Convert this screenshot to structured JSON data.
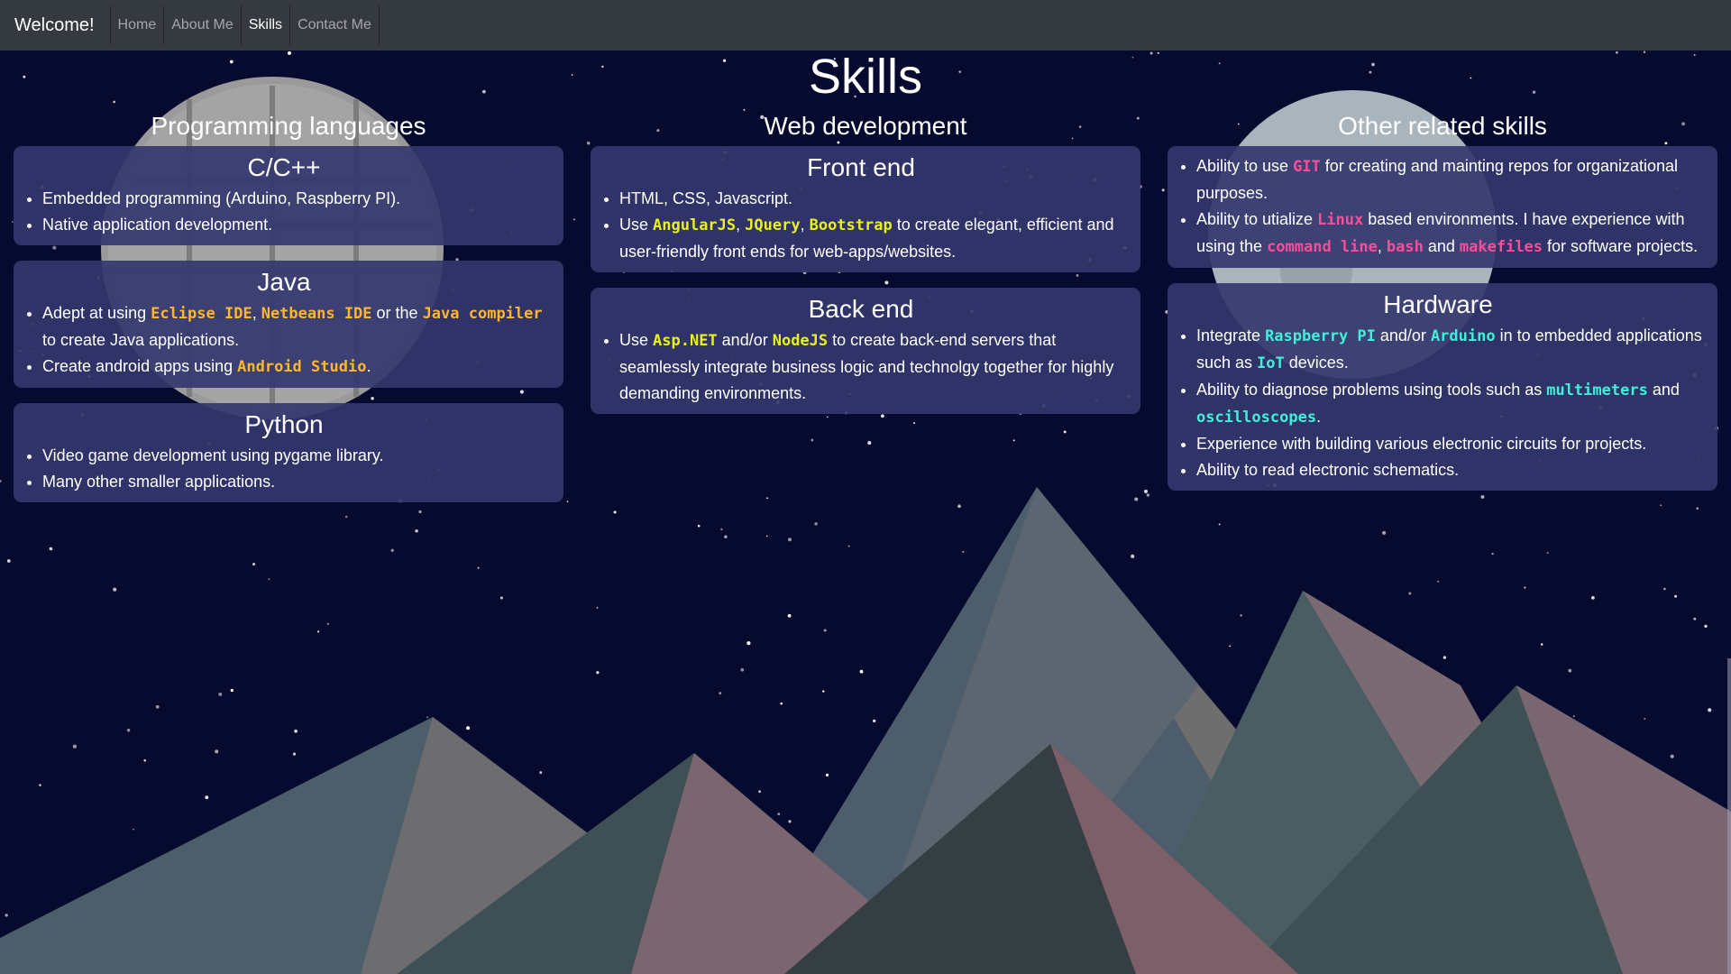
{
  "navbar": {
    "brand": "Welcome!",
    "links": [
      "Home",
      "About Me",
      "Skills",
      "Contact Me"
    ],
    "active": "Skills"
  },
  "page": {
    "title": "Skills"
  },
  "columns": [
    {
      "heading": "Programming languages",
      "cards": [
        {
          "title": "C/C++",
          "items": [
            [
              {
                "t": "Embedded programming (Arduino, Raspberry PI)."
              }
            ],
            [
              {
                "t": "Native application development."
              }
            ]
          ]
        },
        {
          "title": "Java",
          "items": [
            [
              {
                "t": "Adept at using "
              },
              {
                "t": "Eclipse IDE",
                "c": "orange"
              },
              {
                "t": ", "
              },
              {
                "t": "Netbeans IDE",
                "c": "orange"
              },
              {
                "t": " or the "
              },
              {
                "t": "Java compiler",
                "c": "orange"
              },
              {
                "t": " to create Java applications."
              }
            ],
            [
              {
                "t": "Create android apps using "
              },
              {
                "t": "Android Studio",
                "c": "orange"
              },
              {
                "t": "."
              }
            ]
          ]
        },
        {
          "title": "Python",
          "items": [
            [
              {
                "t": "Video game development using pygame library."
              }
            ],
            [
              {
                "t": "Many other smaller applications."
              }
            ]
          ]
        }
      ]
    },
    {
      "heading": "Web development",
      "cards": [
        {
          "title": "Front end",
          "items": [
            [
              {
                "t": "HTML, CSS, Javascript."
              }
            ],
            [
              {
                "t": "Use "
              },
              {
                "t": "AngularJS",
                "c": "yellow"
              },
              {
                "t": ", "
              },
              {
                "t": "JQuery",
                "c": "yellow"
              },
              {
                "t": ", "
              },
              {
                "t": "Bootstrap",
                "c": "yellow"
              },
              {
                "t": " to create elegant, efficient and user-friendly front ends for web-apps/websites."
              }
            ]
          ]
        },
        {
          "title": "Back end",
          "items": [
            [
              {
                "t": "Use "
              },
              {
                "t": "Asp.NET",
                "c": "yellow"
              },
              {
                "t": " and/or "
              },
              {
                "t": "NodeJS",
                "c": "yellow"
              },
              {
                "t": " to create back-end servers that seamlessly integrate business logic and technolgy together for highly demanding environments."
              }
            ]
          ]
        }
      ]
    },
    {
      "heading": "Other related skills",
      "cards": [
        {
          "title": "",
          "items": [
            [
              {
                "t": "Ability to use "
              },
              {
                "t": "GIT",
                "c": "pink"
              },
              {
                "t": " for creating and mainting repos for organizational purposes."
              }
            ],
            [
              {
                "t": "Ability to utialize "
              },
              {
                "t": "Linux",
                "c": "pink"
              },
              {
                "t": " based environments. I have experience with using the "
              },
              {
                "t": "command line",
                "c": "pink"
              },
              {
                "t": ", "
              },
              {
                "t": "bash",
                "c": "pink"
              },
              {
                "t": " and "
              },
              {
                "t": "makefiles",
                "c": "pink"
              },
              {
                "t": " for software projects."
              }
            ]
          ]
        },
        {
          "title": "Hardware",
          "items": [
            [
              {
                "t": "Integrate "
              },
              {
                "t": "Raspberry PI",
                "c": "cyan"
              },
              {
                "t": " and/or "
              },
              {
                "t": "Arduino",
                "c": "cyan"
              },
              {
                "t": " in to embedded applications such as "
              },
              {
                "t": "IoT",
                "c": "cyan"
              },
              {
                "t": " devices."
              }
            ],
            [
              {
                "t": "Ability to diagnose problems using tools such as "
              },
              {
                "t": "multimeters",
                "c": "cyan"
              },
              {
                "t": " and "
              },
              {
                "t": "oscilloscopes",
                "c": "cyan"
              },
              {
                "t": "."
              }
            ],
            [
              {
                "t": "Experience with building various electronic circuits for projects."
              }
            ],
            [
              {
                "t": "Ability to read electronic schematics."
              }
            ]
          ]
        }
      ]
    }
  ],
  "colors": {
    "background": "#050a2e",
    "navbar": "#343a40",
    "card": "#34376e",
    "code_orange": "#ffb52e",
    "code_yellow": "#e8f219",
    "code_pink": "#ff4c9a",
    "code_cyan": "#3ff0d8"
  }
}
